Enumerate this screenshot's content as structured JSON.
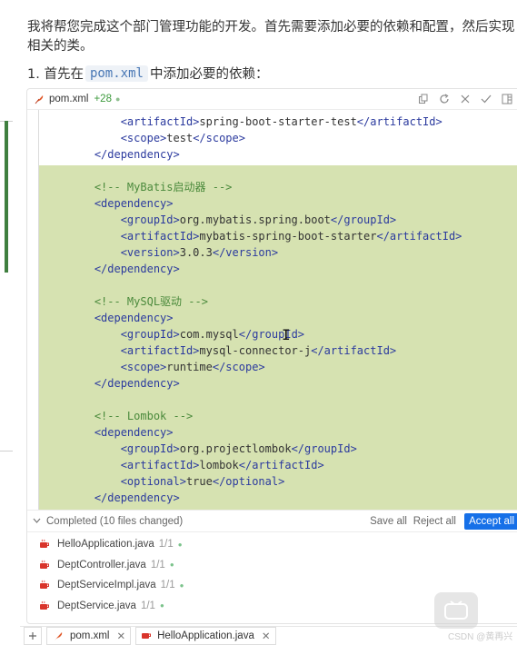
{
  "intro": {
    "paragraph": "我将帮您完成这个部门管理功能的开发。首先需要添加必要的依赖和配置，然后实现相关的类。",
    "step_prefix": "1. 首先在",
    "step_code": "pom.xml",
    "step_suffix": "中添加必要的依赖："
  },
  "editor": {
    "file_name": "pom.xml",
    "added_lines": "+28",
    "header_icons": [
      "copy-icon",
      "refresh-icon",
      "close-icon",
      "check-icon",
      "panel-icon"
    ],
    "code_lines": [
      {
        "indent": "        ",
        "parts": [
          [
            "tag",
            "<artifactId>"
          ],
          [
            "txt",
            "spring-boot-starter-test"
          ],
          [
            "tag",
            "</artifactId>"
          ]
        ]
      },
      {
        "indent": "        ",
        "parts": [
          [
            "tag",
            "<scope>"
          ],
          [
            "txt",
            "test"
          ],
          [
            "tag",
            "</scope>"
          ]
        ]
      },
      {
        "indent": "    ",
        "parts": [
          [
            "tag",
            "</dependency>"
          ]
        ]
      },
      {
        "indent": "",
        "parts": []
      },
      {
        "indent": "    ",
        "parts": [
          [
            "cmt",
            "<!-- MyBatis启动器 -->"
          ]
        ]
      },
      {
        "indent": "    ",
        "parts": [
          [
            "tag",
            "<dependency>"
          ]
        ]
      },
      {
        "indent": "        ",
        "parts": [
          [
            "tag",
            "<groupId>"
          ],
          [
            "txt",
            "org.mybatis.spring.boot"
          ],
          [
            "tag",
            "</groupId>"
          ]
        ]
      },
      {
        "indent": "        ",
        "parts": [
          [
            "tag",
            "<artifactId>"
          ],
          [
            "txt",
            "mybatis-spring-boot-starter"
          ],
          [
            "tag",
            "</artifactId>"
          ]
        ]
      },
      {
        "indent": "        ",
        "parts": [
          [
            "tag",
            "<version>"
          ],
          [
            "txt",
            "3.0.3"
          ],
          [
            "tag",
            "</version>"
          ]
        ]
      },
      {
        "indent": "    ",
        "parts": [
          [
            "tag",
            "</dependency>"
          ]
        ]
      },
      {
        "indent": "",
        "parts": []
      },
      {
        "indent": "    ",
        "parts": [
          [
            "cmt",
            "<!-- MySQL驱动 -->"
          ]
        ]
      },
      {
        "indent": "    ",
        "parts": [
          [
            "tag",
            "<dependency>"
          ]
        ]
      },
      {
        "indent": "        ",
        "parts": [
          [
            "tag",
            "<groupId>"
          ],
          [
            "txt",
            "com.mysql"
          ],
          [
            "tag",
            "</groupId>"
          ]
        ]
      },
      {
        "indent": "        ",
        "parts": [
          [
            "tag",
            "<artifactId>"
          ],
          [
            "txt",
            "mysql-connector-j"
          ],
          [
            "tag",
            "</artifactId>"
          ]
        ]
      },
      {
        "indent": "        ",
        "parts": [
          [
            "tag",
            "<scope>"
          ],
          [
            "txt",
            "runtime"
          ],
          [
            "tag",
            "</scope>"
          ]
        ]
      },
      {
        "indent": "    ",
        "parts": [
          [
            "tag",
            "</dependency>"
          ]
        ]
      },
      {
        "indent": "",
        "parts": []
      },
      {
        "indent": "    ",
        "parts": [
          [
            "cmt",
            "<!-- Lombok -->"
          ]
        ]
      },
      {
        "indent": "    ",
        "parts": [
          [
            "tag",
            "<dependency>"
          ]
        ]
      },
      {
        "indent": "        ",
        "parts": [
          [
            "tag",
            "<groupId>"
          ],
          [
            "txt",
            "org.projectlombok"
          ],
          [
            "tag",
            "</groupId>"
          ]
        ]
      },
      {
        "indent": "        ",
        "parts": [
          [
            "tag",
            "<artifactId>"
          ],
          [
            "txt",
            "lombok"
          ],
          [
            "tag",
            "</artifactId>"
          ]
        ]
      },
      {
        "indent": "        ",
        "parts": [
          [
            "tag",
            "<optional>"
          ],
          [
            "txt",
            "true"
          ],
          [
            "tag",
            "</optional>"
          ]
        ]
      },
      {
        "indent": "    ",
        "parts": [
          [
            "tag",
            "</dependency>"
          ]
        ]
      }
    ]
  },
  "changes": {
    "completed_label": "Completed (10 files changed)",
    "save_all": "Save all",
    "reject_all": "Reject all",
    "accept_all": "Accept all",
    "files": [
      {
        "name": "HelloApplication.java",
        "count": "1/1"
      },
      {
        "name": "DeptController.java",
        "count": "1/1"
      },
      {
        "name": "DeptServiceImpl.java",
        "count": "1/1"
      },
      {
        "name": "DeptService.java",
        "count": "1/1"
      }
    ]
  },
  "tabs": [
    {
      "label": "pom.xml",
      "icon": "feather-icon"
    },
    {
      "label": "HelloApplication.java",
      "icon": "java-icon"
    }
  ],
  "watermark": "CSDN @黄再兴",
  "colors": {
    "accent": "#1670e8",
    "diff_added_bg": "#d6e2b1",
    "xml_tag": "#2b3a9e",
    "xml_comment": "#4b8a3c",
    "added_count": "#3c9a3c"
  }
}
